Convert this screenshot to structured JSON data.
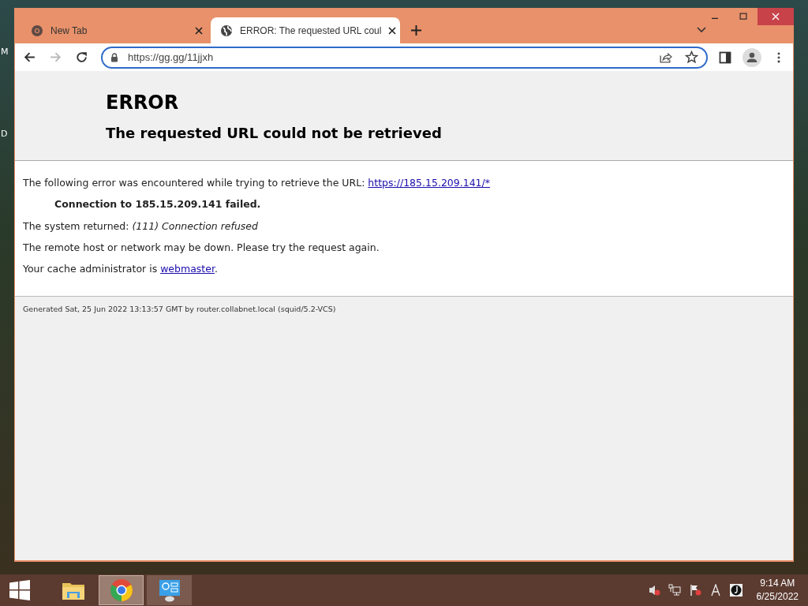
{
  "desktop_labels": [
    {
      "text": "M"
    },
    {
      "text": "D"
    }
  ],
  "tabs": [
    {
      "title": "New Tab",
      "kind": "chrome",
      "selected": false
    },
    {
      "title": "ERROR: The requested URL coul",
      "kind": "globe",
      "selected": true
    }
  ],
  "toolbar": {
    "forward_disabled": true
  },
  "address_bar": {
    "value": "https://gg.gg/11jjxh"
  },
  "page": {
    "heading": "ERROR",
    "subheading": "The requested URL could not be retrieved",
    "paragraphs": [
      {
        "kind": "plain",
        "text": "The following error was encountered while trying to retrieve the URL:",
        "link": "https://185.15.209.141/*"
      },
      {
        "kind": "strong",
        "text": "Connection to 185.15.209.141 failed."
      },
      {
        "kind": "plain",
        "text": "The system returned: *(111) Connection refused*"
      },
      {
        "kind": "plain",
        "text": "The remote host or network may be down. Please try the request again."
      },
      {
        "kind": "plain",
        "text": "Your cache administrator is",
        "link": "webmaster",
        "after": "."
      }
    ],
    "footer": "Generated Sat, 25 Jun 2022 13:13:57 GMT by router.collabnet.local (squid/5.2-VCS)"
  },
  "taskbar": {
    "apps": [
      {
        "kind": "explorer",
        "selected": false
      },
      {
        "kind": "chrome",
        "selected": true
      },
      {
        "kind": "control-panel",
        "selected": false
      }
    ],
    "time": "9:14 AM",
    "date": "6/25/2022"
  }
}
